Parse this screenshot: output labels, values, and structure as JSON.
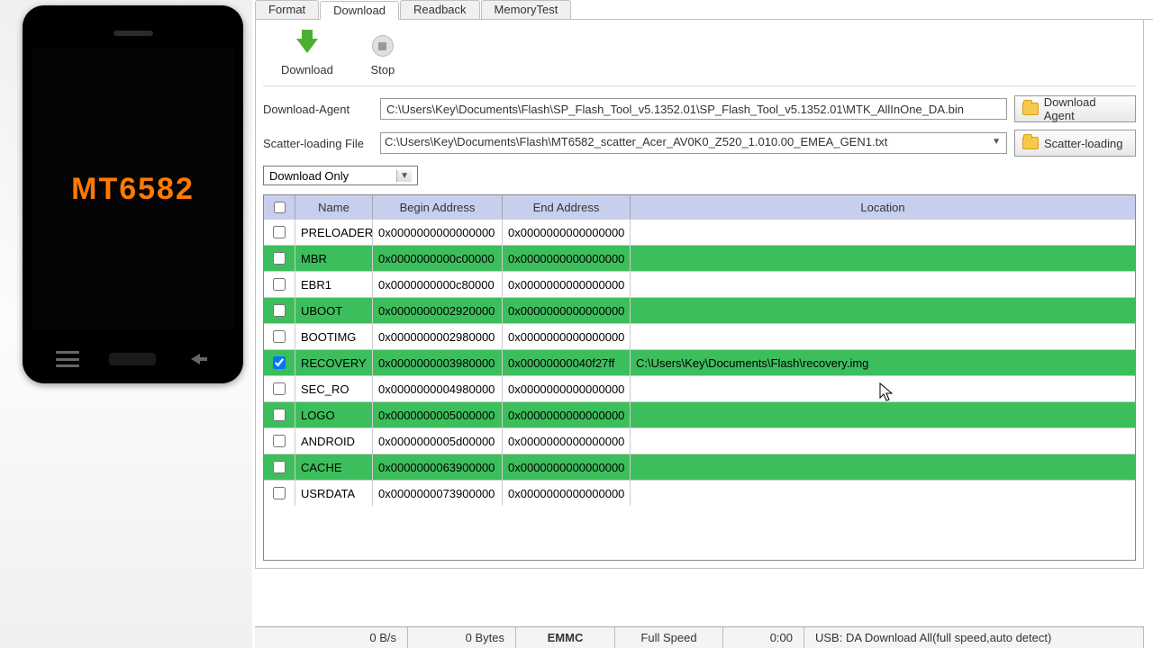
{
  "phone": {
    "chip": "MT6582"
  },
  "tabs": {
    "format": "Format",
    "download": "Download",
    "readback": "Readback",
    "memtest": "MemoryTest"
  },
  "toolbar": {
    "download": "Download",
    "stop": "Stop"
  },
  "form": {
    "agent_label": "Download-Agent",
    "agent_value": "C:\\Users\\Key\\Documents\\Flash\\SP_Flash_Tool_v5.1352.01\\SP_Flash_Tool_v5.1352.01\\MTK_AllInOne_DA.bin",
    "agent_btn": "Download Agent",
    "scatter_label": "Scatter-loading File",
    "scatter_value": "C:\\Users\\Key\\Documents\\Flash\\MT6582_scatter_Acer_AV0K0_Z520_1.010.00_EMEA_GEN1.txt",
    "scatter_btn": "Scatter-loading",
    "mode": "Download Only"
  },
  "table": {
    "headers": {
      "name": "Name",
      "begin": "Begin Address",
      "end": "End Address",
      "location": "Location"
    },
    "rows": [
      {
        "checked": false,
        "color": "white",
        "name": "PRELOADER",
        "begin": "0x0000000000000000",
        "end": "0x0000000000000000",
        "location": ""
      },
      {
        "checked": false,
        "color": "green",
        "name": "MBR",
        "begin": "0x0000000000c00000",
        "end": "0x0000000000000000",
        "location": ""
      },
      {
        "checked": false,
        "color": "white",
        "name": "EBR1",
        "begin": "0x0000000000c80000",
        "end": "0x0000000000000000",
        "location": ""
      },
      {
        "checked": false,
        "color": "green",
        "name": "UBOOT",
        "begin": "0x0000000002920000",
        "end": "0x0000000000000000",
        "location": ""
      },
      {
        "checked": false,
        "color": "white",
        "name": "BOOTIMG",
        "begin": "0x0000000002980000",
        "end": "0x0000000000000000",
        "location": ""
      },
      {
        "checked": true,
        "color": "green",
        "name": "RECOVERY",
        "begin": "0x0000000003980000",
        "end": "0x00000000040f27ff",
        "location": "C:\\Users\\Key\\Documents\\Flash\\recovery.img"
      },
      {
        "checked": false,
        "color": "white",
        "name": "SEC_RO",
        "begin": "0x0000000004980000",
        "end": "0x0000000000000000",
        "location": ""
      },
      {
        "checked": false,
        "color": "green",
        "name": "LOGO",
        "begin": "0x0000000005000000",
        "end": "0x0000000000000000",
        "location": ""
      },
      {
        "checked": false,
        "color": "white",
        "name": "ANDROID",
        "begin": "0x0000000005d00000",
        "end": "0x0000000000000000",
        "location": ""
      },
      {
        "checked": false,
        "color": "green",
        "name": "CACHE",
        "begin": "0x0000000063900000",
        "end": "0x0000000000000000",
        "location": ""
      },
      {
        "checked": false,
        "color": "white",
        "name": "USRDATA",
        "begin": "0x0000000073900000",
        "end": "0x0000000000000000",
        "location": ""
      }
    ]
  },
  "status": {
    "speed": "0 B/s",
    "bytes": "0 Bytes",
    "storage": "EMMC",
    "usbspeed": "Full Speed",
    "time": "0:00",
    "mode": "USB: DA Download All(full speed,auto detect)"
  }
}
